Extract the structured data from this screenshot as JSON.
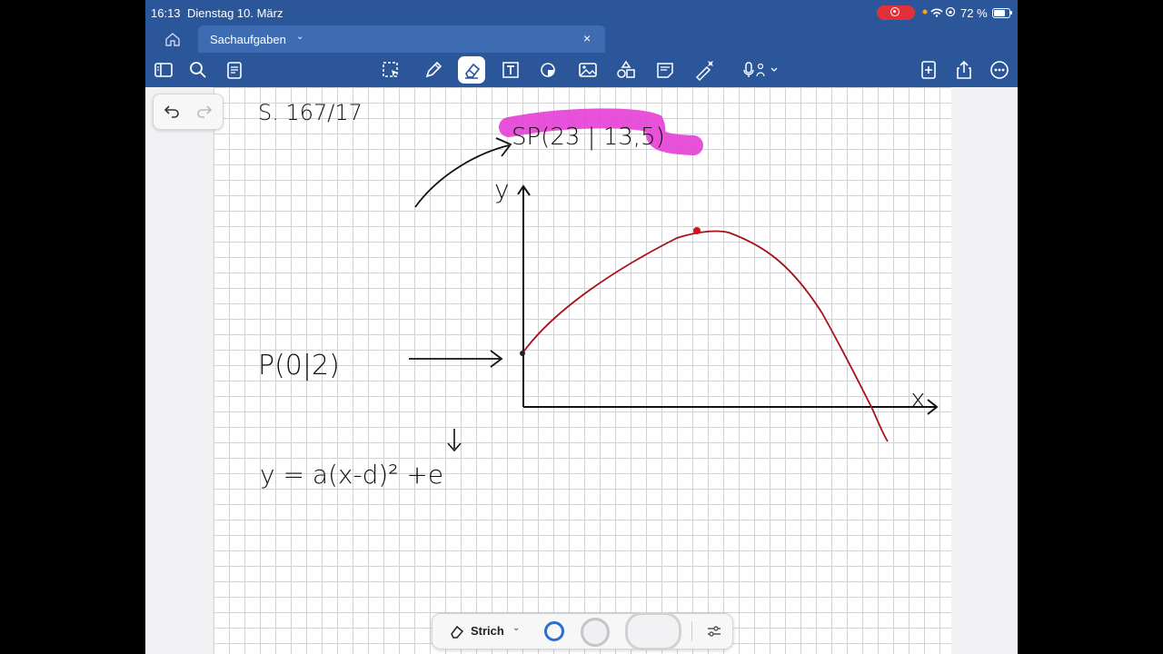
{
  "status_bar": {
    "time": "16:13",
    "date": "Dienstag 10. März",
    "battery": "72 %"
  },
  "tabs": {
    "document_title": "Sachaufgaben"
  },
  "toolbar_icons": [
    "sidebar-icon",
    "search-icon",
    "document-icon",
    "lasso-select-icon",
    "pen-icon",
    "eraser-icon",
    "text-box-icon",
    "shapes-icon",
    "image-icon",
    "stickers-icon",
    "note-icon",
    "laser-pointer-icon",
    "microphone-icon",
    "add-page-icon",
    "share-icon",
    "more-icon"
  ],
  "handwriting": {
    "page_ref": "S. 167/17",
    "vertex": "SP(23 | 13,5)",
    "point": "P(0|2)",
    "formula": "y = a(x-d)² +e",
    "axis_y": "y",
    "axis_x": "x"
  },
  "pen_bar": {
    "mode_label": "Strich"
  },
  "colors": {
    "app_blue": "#2b579a",
    "highlight": "#e63fd6",
    "curve": "#a8101a",
    "ink": "#111111"
  }
}
